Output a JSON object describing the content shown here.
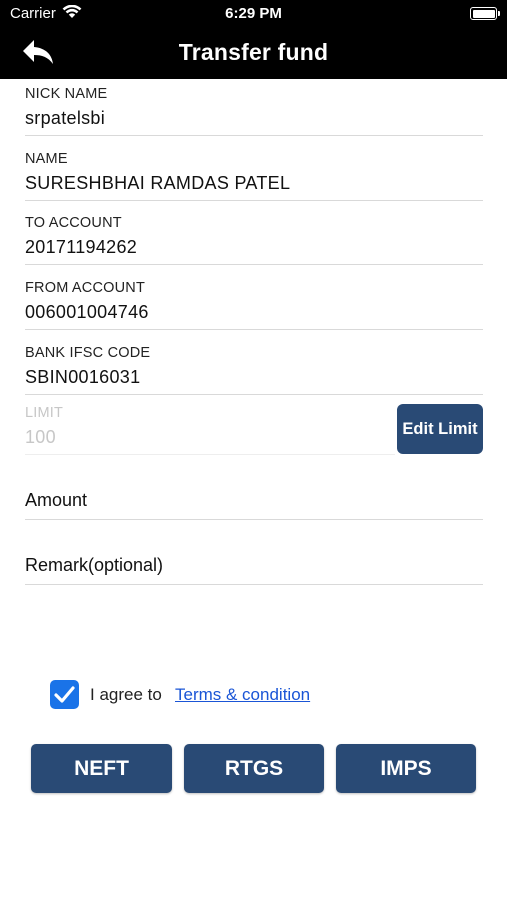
{
  "status_bar": {
    "carrier": "Carrier",
    "time": "6:29 PM"
  },
  "nav": {
    "title": "Transfer fund"
  },
  "fields": [
    {
      "label": "NICK NAME",
      "value": "srpatelsbi"
    },
    {
      "label": "NAME",
      "value": "SURESHBHAI RAMDAS PATEL"
    },
    {
      "label": "TO ACCOUNT",
      "value": "20171194262"
    },
    {
      "label": "FROM ACCOUNT",
      "value": "006001004746"
    },
    {
      "label": "BANK IFSC CODE",
      "value": "SBIN0016031"
    },
    {
      "label": "LIMIT",
      "value": "100"
    }
  ],
  "edit_limit_label": "Edit Limit",
  "amount": {
    "placeholder": "Amount"
  },
  "remark": {
    "placeholder": "Remark(optional)"
  },
  "agreement": {
    "text": "I agree to",
    "link": "Terms & condition",
    "checked": true
  },
  "buttons": {
    "neft": "NEFT",
    "rtgs": "RTGS",
    "imps": "IMPS"
  },
  "colors": {
    "nav_bg": "#000000",
    "button_bg": "#294a75",
    "checkbox": "#1a73e8",
    "link": "#1a55d6"
  }
}
